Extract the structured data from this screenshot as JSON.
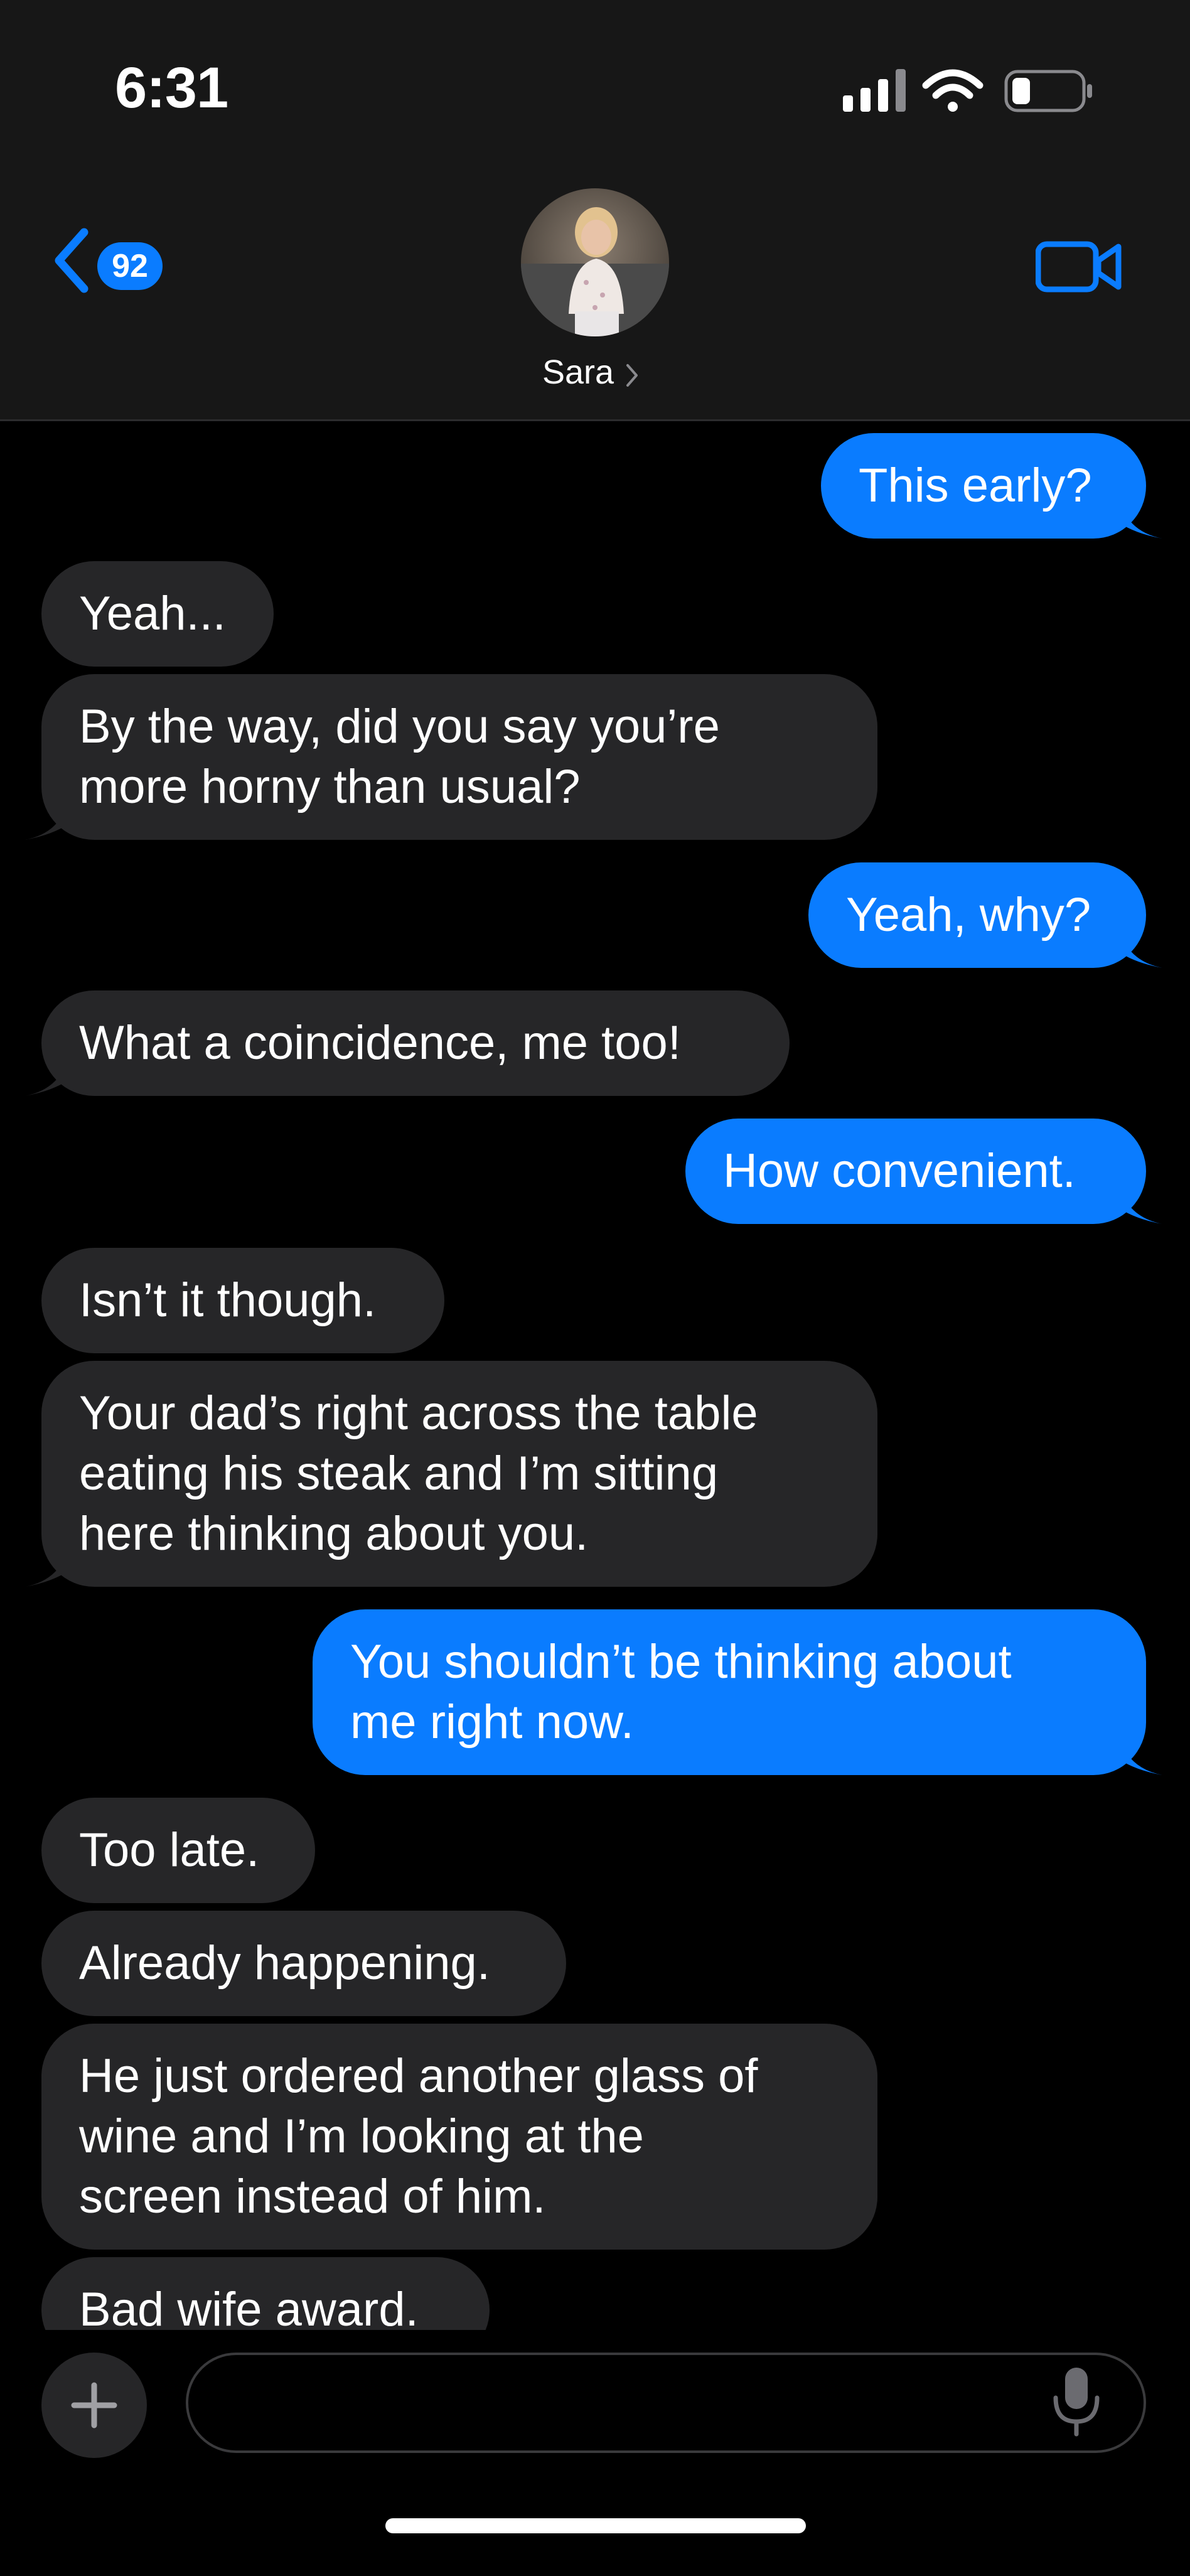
{
  "status_bar": {
    "time": "6:31",
    "icons": [
      "cellular-signal-icon",
      "wifi-icon",
      "battery-low-icon"
    ]
  },
  "header": {
    "unread_count": "92",
    "contact_name": "Sara",
    "icons": [
      "back-chevron-icon",
      "chevron-right-icon",
      "video-camera-icon"
    ]
  },
  "colors": {
    "accent": "#0a7cff",
    "incoming_bubble": "#262628",
    "header_bg": "#171717",
    "background": "#000000"
  },
  "messages": [
    {
      "sender": "me",
      "lines": [
        "This early?"
      ]
    },
    {
      "sender": "Sara",
      "lines": [
        "Yeah..."
      ]
    },
    {
      "sender": "Sara",
      "lines": [
        "By the way, did you say you’re",
        "more horny than usual?"
      ]
    },
    {
      "sender": "me",
      "lines": [
        "Yeah, why?"
      ]
    },
    {
      "sender": "Sara",
      "lines": [
        "What a coincidence, me too!"
      ]
    },
    {
      "sender": "me",
      "lines": [
        "How convenient."
      ]
    },
    {
      "sender": "Sara",
      "lines": [
        "Isn’t it though."
      ]
    },
    {
      "sender": "Sara",
      "lines": [
        "Your dad’s right across the table",
        "eating his steak and I’m sitting",
        "here thinking about you."
      ]
    },
    {
      "sender": "me",
      "lines": [
        "You shouldn’t be thinking about",
        "me right now."
      ]
    },
    {
      "sender": "Sara",
      "lines": [
        "Too late."
      ]
    },
    {
      "sender": "Sara",
      "lines": [
        "Already happening."
      ]
    },
    {
      "sender": "Sara",
      "lines": [
        "He just ordered another glass of",
        "wine and I’m looking at the",
        "screen instead of him."
      ]
    },
    {
      "sender": "Sara",
      "lines": [
        "Bad wife award."
      ]
    }
  ],
  "composer": {
    "input_value": "",
    "icons": [
      "plus-icon",
      "microphone-icon"
    ]
  }
}
